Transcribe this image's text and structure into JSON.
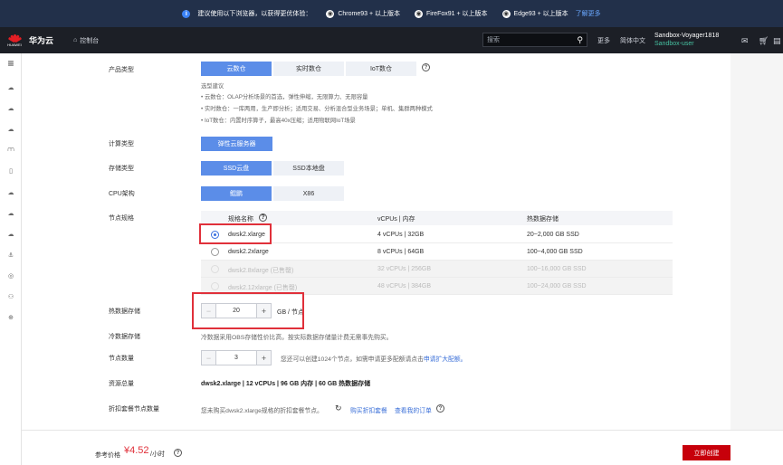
{
  "notice": {
    "text": "建议使用以下浏览器，以获得更优体验：",
    "chrome": "Chrome93 + 以上版本",
    "firefox": "FireFox91 + 以上版本",
    "edge": "Edge93 + 以上版本",
    "more": "了解更多"
  },
  "topbar": {
    "logo_caption": "HUAWEI",
    "brand": "华为云",
    "console": "控制台",
    "search_placeholder": "搜索",
    "more": "更多",
    "lang": "简体中文",
    "user_name": "Sandbox-Voyager1818",
    "user_sub": "Sandbox-user"
  },
  "form": {
    "product_type": {
      "label": "产品类型",
      "options": [
        "云数仓",
        "实时数仓",
        "IoT数仓"
      ],
      "selected": "云数仓",
      "tips_title": "选型建议",
      "tips": [
        "• 云数仓：OLAP分析场景的首选，弹性伸缩，无限算力、无限容量",
        "• 实时数仓：一库两用，生产即分析；适用交易、分析混合型业务场景；单机、集群两种模式",
        "• IoT数仓：内置时序算子，最高40x压缩；适用物联网IoT场景"
      ]
    },
    "compute_type": {
      "label": "计算类型",
      "options": [
        "弹性云服务器"
      ]
    },
    "storage_type": {
      "label": "存储类型",
      "options": [
        "SSD云盘",
        "SSD本地盘"
      ],
      "selected": "SSD云盘"
    },
    "cpu_arch": {
      "label": "CPU架构",
      "options": [
        "鲲鹏",
        "X86"
      ],
      "selected": "鲲鹏"
    },
    "node_spec": {
      "label": "节点规格",
      "columns": [
        "规格名称",
        "vCPUs | 内存",
        "热数据存储"
      ],
      "rows": [
        {
          "name": "dwsk2.xlarge",
          "vcpu": "4 vCPUs | 32GB",
          "storage": "20~2,000 GB SSD",
          "selected": true,
          "disabled": false
        },
        {
          "name": "dwsk2.2xlarge",
          "vcpu": "8 vCPUs | 64GB",
          "storage": "100~4,000 GB SSD",
          "selected": false,
          "disabled": false
        },
        {
          "name": "dwsk2.8xlarge (已售罄)",
          "vcpu": "32 vCPUs | 256GB",
          "storage": "100~16,000 GB SSD",
          "selected": false,
          "disabled": true
        },
        {
          "name": "dwsk2.12xlarge (已售罄)",
          "vcpu": "48 vCPUs | 384GB",
          "storage": "100~24,000 GB SSD",
          "selected": false,
          "disabled": true
        }
      ]
    },
    "hot_storage": {
      "label": "热数据存储",
      "value": "20",
      "unit": "GB / 节点"
    },
    "cold_storage": {
      "label": "冷数据存储",
      "text": "冷数据采用OBS存储性价比高，按实际数据存储量计费无需事先购买。"
    },
    "node_count": {
      "label": "节点数量",
      "value": "3",
      "hint": "您还可以创建1024个节点，如需申请更多配额请点击",
      "hint_link": "申请扩大配额。"
    },
    "resources": {
      "label": "资源总量",
      "value": "dwsk2.xlarge | 12 vCPUs | 96 GB 内存 | 60 GB 热数据存储"
    },
    "discount": {
      "label": "折扣套餐节点数量",
      "text": "您未购买dwsk2.xlarge规格的折扣套餐节点。",
      "buy_link": "购买折扣套餐",
      "orders_link": "查看我的订单"
    }
  },
  "footer": {
    "price_label": "参考价格",
    "price": "¥4.52",
    "price_unit": "/小时",
    "buy_button": "立即创建"
  },
  "sidebar": {
    "icons": [
      "menu-icon",
      "cloud-icon",
      "cloud-icon",
      "cloud-icon",
      "bridge-icon",
      "file-icon",
      "cloud-icon",
      "cloud-icon",
      "cloud-icon",
      "anchor-icon",
      "compass-icon",
      "users-icon",
      "globe-icon"
    ]
  }
}
